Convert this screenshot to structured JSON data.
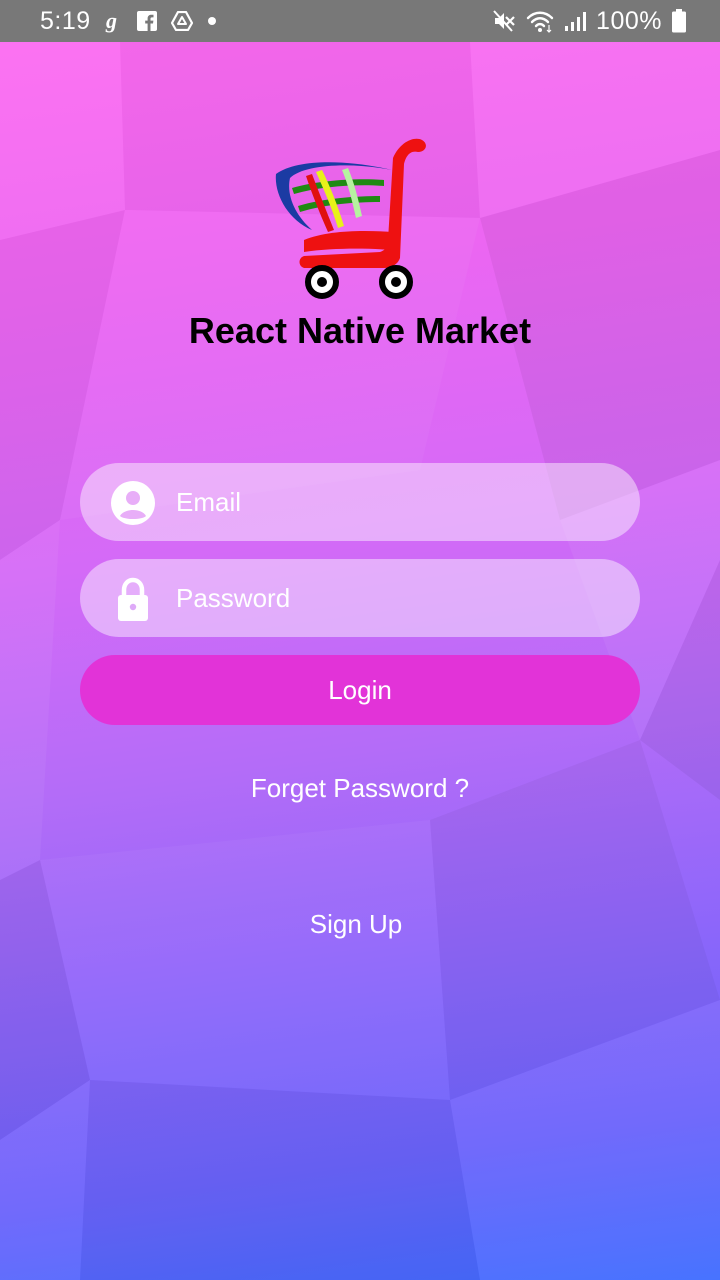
{
  "status_bar": {
    "time": "5:19",
    "battery": "100%",
    "icons": [
      "g-app-icon",
      "facebook-icon",
      "drive-icon",
      "notification-dot-icon",
      "mute-icon",
      "wifi-icon",
      "signal-icon",
      "battery-icon"
    ]
  },
  "app": {
    "title": "React Native Market",
    "logo_icon": "shopping-cart-logo"
  },
  "form": {
    "email_placeholder": "Email",
    "password_placeholder": "Password",
    "email_icon": "user-circle-icon",
    "password_icon": "lock-icon",
    "login_label": "Login",
    "forgot_label": "Forget Password ?",
    "signup_label": "Sign Up"
  },
  "colors": {
    "status_bar": "#787878",
    "gradient_top": "#ff6cf2",
    "gradient_bottom": "#3e6cff",
    "login_button": "#e233d8",
    "title": "#000000"
  }
}
